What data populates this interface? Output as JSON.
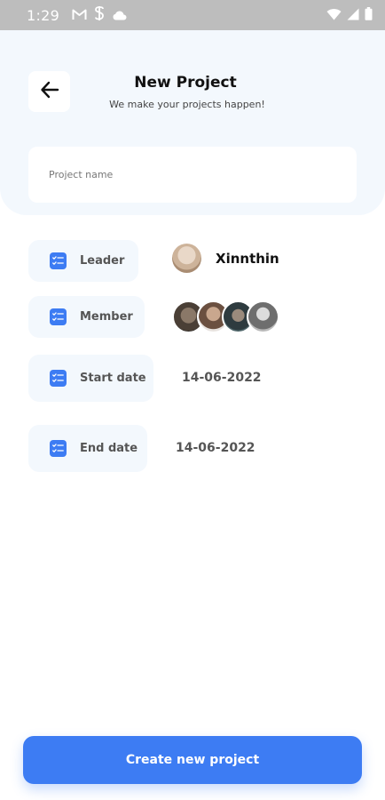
{
  "status_bar": {
    "time": "1:29",
    "left_icons": [
      "gmail-icon",
      "s-app-icon",
      "cloud-icon"
    ],
    "right_icons": [
      "wifi-icon",
      "signal-icon",
      "battery-icon"
    ]
  },
  "header": {
    "back_icon": "arrow-left-icon",
    "title": "New Project",
    "subtitle": "We make your projects happen!"
  },
  "form": {
    "project_name": {
      "placeholder": "Project name",
      "value": ""
    },
    "leader": {
      "label": "Leader",
      "name": "Xinnthin"
    },
    "member": {
      "label": "Member",
      "avatar_count": 4
    },
    "start_date": {
      "label": "Start date",
      "value": "14-06-2022"
    },
    "end_date": {
      "label": "End date",
      "value": "14-06-2022"
    }
  },
  "actions": {
    "create_label": "Create new project"
  },
  "colors": {
    "accent": "#3d7cf3",
    "panel_background": "#f3f8fd",
    "status_bar": "#bdbdbd"
  }
}
